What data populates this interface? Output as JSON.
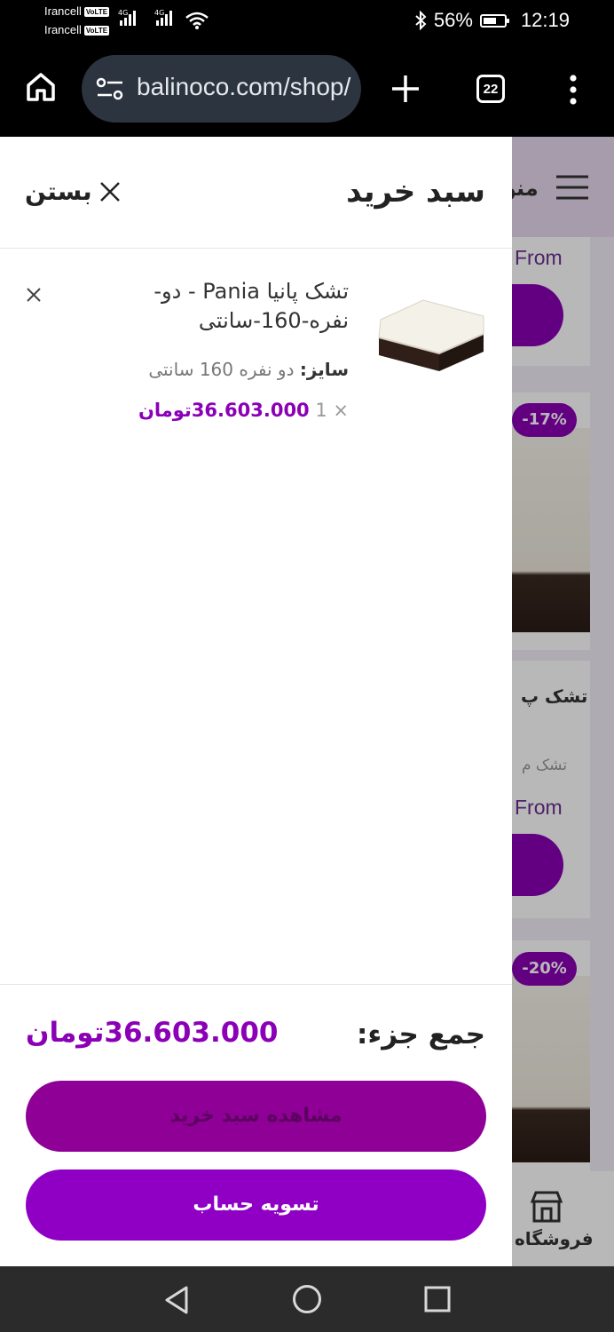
{
  "status": {
    "carrier1": "Irancell",
    "carrier2": "Irancell",
    "volte": "VoLTE",
    "net": "4G",
    "battery": "56%",
    "time": "12:19"
  },
  "browser": {
    "url": "balinoco.com/shop/",
    "tabs": "22",
    "icons": [
      "home-icon",
      "site-settings-icon",
      "new-tab-icon",
      "tab-switcher-icon",
      "more-menu-icon"
    ]
  },
  "background": {
    "menu_label": "منو",
    "from_1": "From",
    "from_2": "From",
    "badge_1": "-17%",
    "badge_2": "-20%",
    "product_fragment": "تشک پ",
    "product_subfragment": "تشک م",
    "shop_label": "فروشگاه"
  },
  "cart": {
    "title": "سبد خرید",
    "close_label": "بستن",
    "items": [
      {
        "name": "تشک پانیا Pania - دو-نفره-160-سانتی",
        "size_label": "سایز:",
        "size_value": "دو نفره 160 سانتی",
        "qty": "1 ×",
        "price": "36.603.000تومان"
      }
    ],
    "subtotal_label": "جمع جزء:",
    "subtotal_value": "36.603.000تومان",
    "view_cart_button": "مشاهده سبد خرید",
    "checkout_button": "تسویه حساب"
  },
  "colors": {
    "accent": "#8b00b6",
    "view_button": "#8f0096",
    "checkout_button": "#9000c4"
  }
}
